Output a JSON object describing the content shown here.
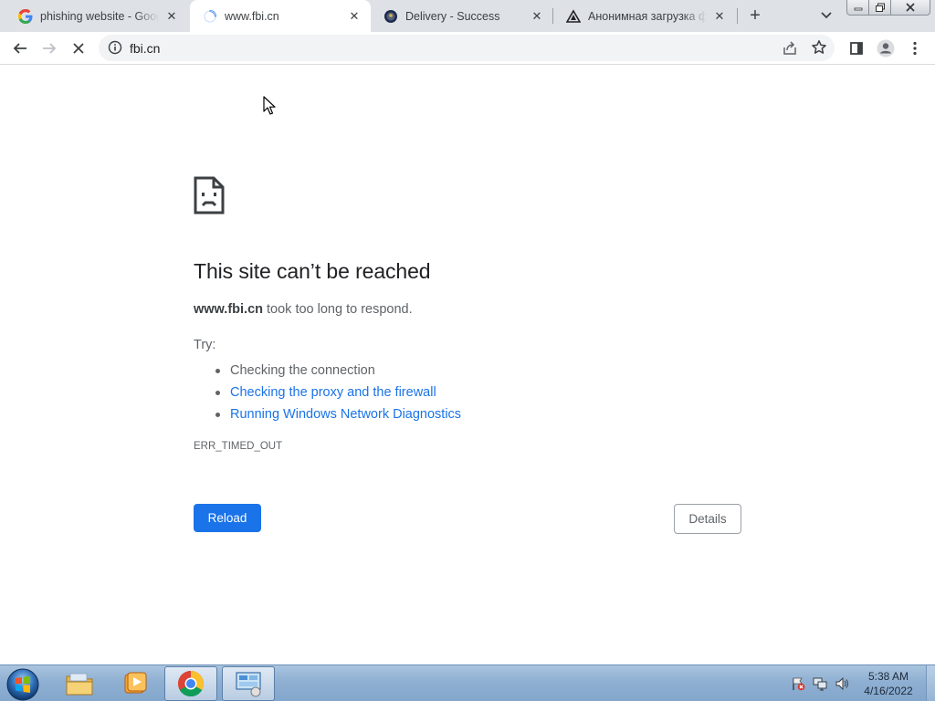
{
  "tabs": [
    {
      "title": "phishing website - Google",
      "favicon": "google-g-icon",
      "close": "✕"
    },
    {
      "title": "www.fbi.cn",
      "favicon": "loading-spinner-icon",
      "close": "✕"
    },
    {
      "title": "Delivery - Success",
      "favicon": "seal-icon",
      "close": "✕"
    },
    {
      "title": "Анонимная загрузка фа",
      "favicon": "triangle-icon",
      "close": "✕"
    }
  ],
  "toolbar": {
    "url": "fbi.cn",
    "new_tab": "+"
  },
  "error": {
    "title": "This site can’t be reached",
    "host": "www.fbi.cn",
    "description_rest": " took too long to respond.",
    "try_label": "Try:",
    "suggestions": [
      "Checking the connection",
      "Checking the proxy and the firewall",
      "Running Windows Network Diagnostics"
    ],
    "code": "ERR_TIMED_OUT",
    "reload_label": "Reload",
    "details_label": "Details"
  },
  "taskbar": {
    "time": "5:38 AM",
    "date": "4/16/2022"
  },
  "colors": {
    "accent": "#1a73e8",
    "tabstrip": "#dee1e6",
    "text_secondary": "#5f6368"
  }
}
